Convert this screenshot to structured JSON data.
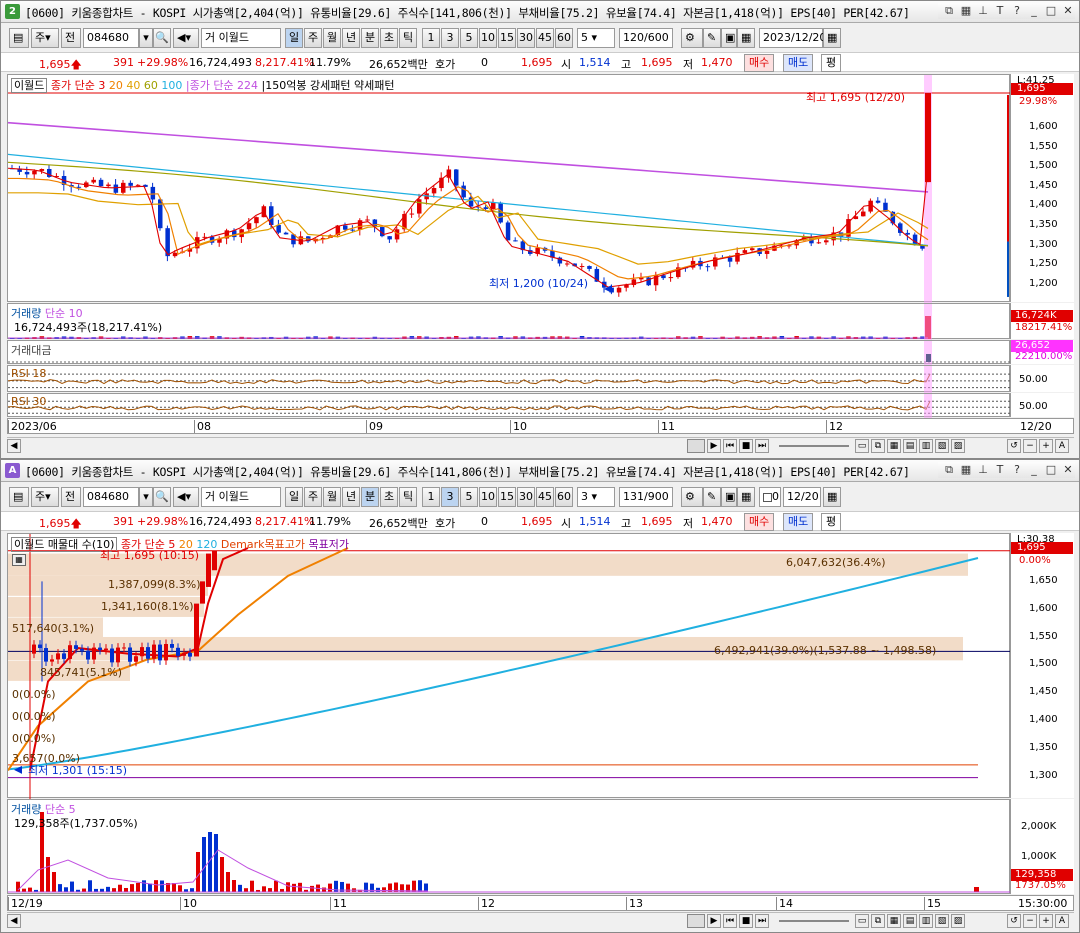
{
  "top": {
    "icon": "2",
    "title": "[0600] 키움종합차트 - KOSPI 시가총액[2,404(억)] 유통비율[29.6] 주식수[141,806(천)] 부채비율[75.2] 유보율[74.4] 자본금[1,418(억)] EPS[40] PER[42.67]",
    "toolbar": {
      "mode": "주",
      "prev": "전",
      "code": "084680",
      "name": "이월드",
      "name_prefix": "거",
      "periods": [
        "일",
        "주",
        "월",
        "년",
        "분",
        "초",
        "틱"
      ],
      "selected_period": "일",
      "intervals": [
        "1",
        "3",
        "5",
        "10",
        "15",
        "30",
        "45",
        "60"
      ],
      "interval_value": "5",
      "count": "120",
      "count_max": "/600",
      "date": "2023/12/20"
    },
    "quote": {
      "price": "1,695",
      "change": "391",
      "pct": "+29.98%",
      "volume": "16,724,493",
      "turnover": "8,217.41%",
      "rate": "11.79%",
      "amount": "26,652백만",
      "hoga_label": "호가",
      "hoga": "0",
      "hoga_price": "1,695",
      "open_label": "시",
      "open": "1,514",
      "high_label": "고",
      "high": "1,695",
      "low_label": "저",
      "low": "1,470",
      "buy": "매수",
      "sell": "매도",
      "avg": "평"
    },
    "legend": {
      "name": "이월드",
      "ma_label": "종가 단순 3",
      "ma_periods": [
        "20",
        "40",
        "60",
        "100"
      ],
      "ma224": "종가 단순 224",
      "pattern": "150억봉 강세패턴",
      "pattern2": "약세패턴"
    },
    "high_label": "최고 1,695 (12/20)",
    "low_label": "최저 1,200 (10/24)",
    "price_axis": [
      "1,600",
      "1,550",
      "1,500",
      "1,450",
      "1,400",
      "1,350",
      "1,300",
      "1,250",
      "1,200"
    ],
    "axis_top": "L:41.25",
    "axis_price_box": "1,695",
    "axis_pct": "29.98%",
    "volume_label": "거래량",
    "volume_ma": "단순 10",
    "volume_value": "16,724,493주(18,217.41%)",
    "volume_box": "16,724K",
    "volume_pct": "18217.41%",
    "amount_label": "거래대금",
    "amount_box": "26,652",
    "amount_pct": "22210.00%",
    "rsi18": "RSI 18",
    "rsi30": "RSI 30",
    "rsi_level": "50.00",
    "dates": [
      "2023/06",
      "08",
      "09",
      "10",
      "11",
      "12"
    ],
    "date_end": "12/20"
  },
  "bottom": {
    "icon": "A",
    "title": "[0600] 키움종합차트 - KOSPI 시가총액[2,404(억)] 유통비율[29.6] 주식수[141,806(천)] 부채비율[75.2] 유보율[74.4] 자본금[1,418(억)] EPS[40] PER[42.67]",
    "toolbar": {
      "mode": "주",
      "prev": "전",
      "code": "084680",
      "name": "이월드",
      "name_prefix": "거",
      "periods": [
        "일",
        "주",
        "월",
        "년",
        "분",
        "초",
        "틱"
      ],
      "selected_period": "분",
      "intervals": [
        "1",
        "3",
        "5",
        "10",
        "15",
        "30",
        "45",
        "60"
      ],
      "interval_value": "3",
      "count": "131",
      "count_max": "/900",
      "date_flag": "0",
      "date": "12/20"
    },
    "quote": {
      "price": "1,695",
      "change": "391",
      "pct": "+29.98%",
      "volume": "16,724,493",
      "turnover": "8,217.41%",
      "rate": "11.79%",
      "amount": "26,652백만",
      "hoga_label": "호가",
      "hoga": "0",
      "hoga_price": "1,695",
      "open_label": "시",
      "open": "1,514",
      "high_label": "고",
      "high": "1,695",
      "low_label": "저",
      "low": "1,470",
      "buy": "매수",
      "sell": "매도",
      "avg": "평"
    },
    "legend": {
      "name": "이월드 매물대 수(10)",
      "ma_label": "종가 단순 5",
      "ma_periods": [
        "20",
        "120"
      ],
      "demark_hi": "Demark목표고가",
      "demark_lo": "목표저가"
    },
    "high_label": "최고 1,695 (10:15)",
    "low_label": "최저 1,301 (15:15)",
    "profile": [
      "1,387,099(8.3%)",
      "1,341,160(8.1%)",
      "517,640(3.1%)",
      "845,741(5.1%)",
      "0(0.0%)",
      "0(0.0%)",
      "0(0.0%)",
      "3,657(0.0%)"
    ],
    "profile_big1": "6,047,632(36.4%)",
    "profile_big2": "6,492,941(39.0%)(1,537.88 ~ 1,498.58)",
    "price_axis": [
      "1,650",
      "1,600",
      "1,550",
      "1,500",
      "1,450",
      "1,400",
      "1,350",
      "1,300"
    ],
    "axis_top": "L:30.38",
    "axis_price_box": "1,695",
    "axis_pct": "0.00%",
    "volume_label": "거래량",
    "volume_ma": "단순 5",
    "volume_value": "129,358주(1,737.05%)",
    "vol_axis": [
      "2,000K",
      "1,000K"
    ],
    "volume_box": "129,358",
    "volume_pct": "1737.05%",
    "dates": [
      "12/19",
      "10",
      "11",
      "12",
      "13",
      "14",
      "15"
    ],
    "date_end": "15:30:00"
  },
  "colors": {
    "up": "#e00000",
    "down": "#0030d0",
    "ma224": "#c050e0",
    "ma_cyan": "#20b0e0",
    "ma_orange": "#f08000",
    "ma_olive": "#a0a000",
    "highlight": "#ff99ff"
  }
}
